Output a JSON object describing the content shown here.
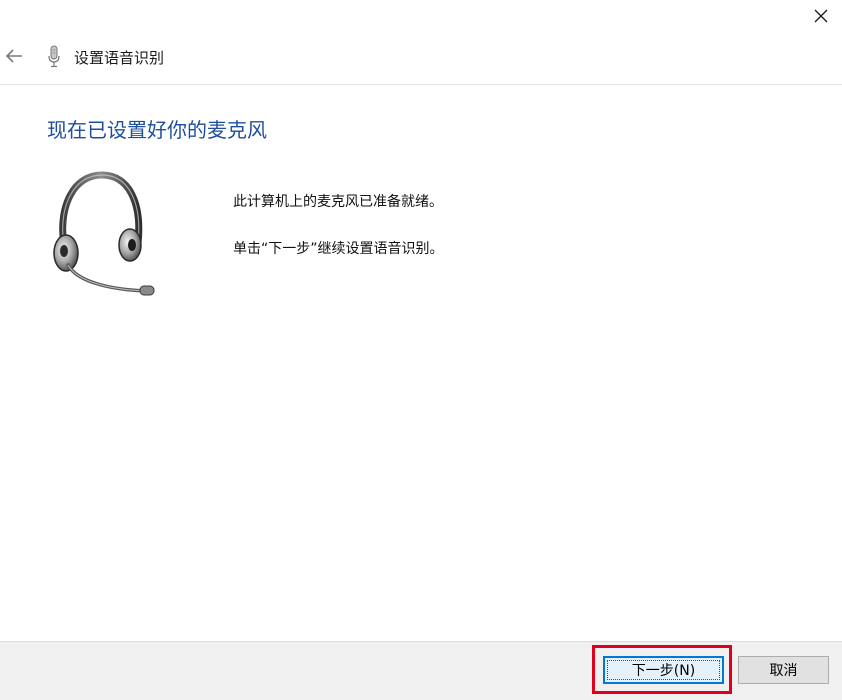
{
  "window": {
    "close_icon": "close-icon"
  },
  "header": {
    "back_icon": "back-arrow-icon",
    "app_icon": "microphone-icon",
    "title": "设置语音识别"
  },
  "main": {
    "heading": "现在已设置好你的麦克风",
    "illustration": "headset-icon",
    "line1": "此计算机上的麦克风已准备就绪。",
    "line2": "单击“下一步”继续设置语音识别。"
  },
  "footer": {
    "next_label": "下一步(N)",
    "cancel_label": "取消"
  },
  "colors": {
    "heading": "#1f4e9e",
    "highlight": "#e0001b",
    "focus_border": "#0078d7",
    "footer_bg": "#f0f0f0"
  }
}
